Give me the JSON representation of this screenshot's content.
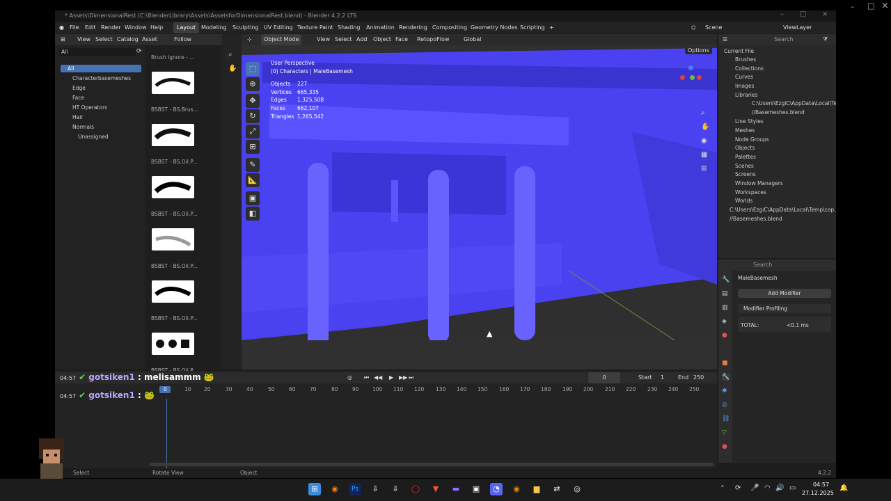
{
  "window": {
    "title": "* Assets\\DimensionalRest (C:\\BlenderLibrary\\Assets\\AssetsforDimensionalRest.blend) - Blender 4.2.2 LTS",
    "minimize": "–",
    "maximize": "□",
    "close": "×"
  },
  "menu": {
    "items": [
      "File",
      "Edit",
      "Render",
      "Window",
      "Help"
    ],
    "workspaces": [
      "Layout",
      "Modeling",
      "Sculpting",
      "UV Editing",
      "Texture Paint",
      "Shading",
      "Animation",
      "Rendering",
      "Compositing",
      "Geometry Nodes",
      "Scripting"
    ],
    "add_tab": "+",
    "scene": "Scene",
    "view_layer": "ViewLayer"
  },
  "asset_browser": {
    "menus": [
      "View",
      "Select",
      "Catalog",
      "Asset"
    ],
    "follow_prefs": "Follow Preferences",
    "filter": "All",
    "catalog_root": "All",
    "catalogs": [
      "Characterbasemeshes",
      "Edge",
      "Face",
      "HT Operators",
      "Hair",
      "Normals",
      "Unassigned"
    ],
    "brush_header": "Brush Ignore - ...",
    "brushes": [
      "BSBST - BS.Brus...",
      "BSBST - BS.Oil.P...",
      "BSBST - BS.Oil.P...",
      "BSBST - BS.Oil.P...",
      "BSBST - BS.Oil.P...",
      "BSBST - BS.Oil.P..."
    ]
  },
  "viewport": {
    "mode": "Object Mode",
    "menus": [
      "View",
      "Select",
      "Add",
      "Object",
      "Face"
    ],
    "addon": "RetopoFlow",
    "orientation": "Global",
    "options": "Options",
    "perspective": "User Perspective",
    "collection": "(0) Characters | MaleBasemesh",
    "stats": [
      {
        "label": "Objects",
        "value": "227"
      },
      {
        "label": "Vertices",
        "value": "665,335"
      },
      {
        "label": "Edges",
        "value": "1,325,508"
      },
      {
        "label": "Faces",
        "value": "662,107"
      },
      {
        "label": "Triangles",
        "value": "1,265,542"
      }
    ]
  },
  "outliner": {
    "search_placeholder": "Search",
    "root": "Current File",
    "items": [
      "Brushes",
      "Collections",
      "Curves",
      "Images",
      "Libraries",
      "C:\\Users\\EzgiC\\AppData\\Local\\Te...",
      "//Basemeshes.blend",
      "Line Styles",
      "Meshes",
      "Node Groups",
      "Objects",
      "Palettes",
      "Scenes",
      "Screens",
      "Window Managers",
      "Workspaces",
      "Worlds",
      "C:\\Users\\EzgiC\\AppData\\Local\\Temp\\cop...",
      "//Basemeshes.blend"
    ]
  },
  "properties": {
    "search_placeholder": "Search",
    "object_name": "MaleBasemesh",
    "add_modifier": "Add Modifier",
    "profiling": "Modifier Profiling",
    "total_label": "TOTAL:",
    "total_value": "<0.1 ms"
  },
  "timeline": {
    "current_frame": "0",
    "start_label": "Start",
    "start": "1",
    "end_label": "End",
    "end": "250",
    "ticks": [
      "0",
      "10",
      "20",
      "30",
      "40",
      "50",
      "60",
      "70",
      "80",
      "90",
      "100",
      "110",
      "120",
      "130",
      "140",
      "150",
      "160",
      "170",
      "180",
      "190",
      "200",
      "210",
      "220",
      "230",
      "240",
      "250"
    ]
  },
  "statusbar": {
    "select": "Select",
    "rotate": "Rotate View",
    "object": "Object",
    "version": "4.2.2"
  },
  "chat": [
    {
      "time": "04:57",
      "user": "gotsiken1",
      "message": ": melisammm"
    },
    {
      "time": "04:57",
      "user": "gotsiken1",
      "message": ":"
    }
  ],
  "taskbar": {
    "time": "04:57",
    "date": "27.12.2025"
  },
  "colors": {
    "viewport_blue": "#4a42f0",
    "accent": "#4772b3",
    "chat_user": "#b8a8ff"
  }
}
